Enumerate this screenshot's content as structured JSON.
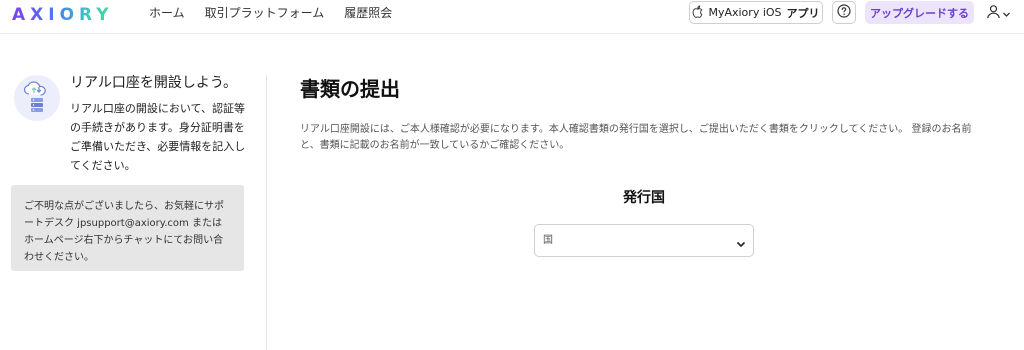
{
  "header": {
    "logo": "AXIORY",
    "nav": [
      "ホーム",
      "取引プラットフォーム",
      "履歴照会"
    ],
    "ios_app_prefix": "MyAxiory iOS",
    "ios_app_bold": "アプリ",
    "upgrade_label": "アップグレードする",
    "brand_gradient": [
      "#7b3ff2",
      "#4a7ee8",
      "#3ac9c0",
      "#55d39b"
    ],
    "upgrade_bg": "#ece4fb",
    "upgrade_color": "#6a3fcf",
    "icons": {
      "apple": "apple-icon",
      "help": "question-circle-icon",
      "user": "user-icon",
      "user_chevron": "chevron-down-icon"
    }
  },
  "sidebar": {
    "promo_icon": "cloud-database-icon",
    "promo_title": "リアル口座を開設しよう。",
    "promo_body": "リアル口座の開設において、認証等の手続きがあります。身分証明書をご準備いただき、必要情報を記入してください。",
    "help_text": "ご不明な点がございましたら、お気軽にサポートデスク jpsupport@axiory.com またはホームページ右下からチャットにてお問い合わせください。"
  },
  "main": {
    "title": "書類の提出",
    "intro": "リアル口座開設には、ご本人様確認が必要になります。本人確認書類の発行国を選択し、ご提出いただく書類をクリックしてください。 登録のお名前と、書類に記載のお名前が一致しているかご確認ください。",
    "issuing_country_label": "発行国",
    "country_select": {
      "value": "国",
      "chevron_icon": "chevron-down-icon"
    }
  }
}
